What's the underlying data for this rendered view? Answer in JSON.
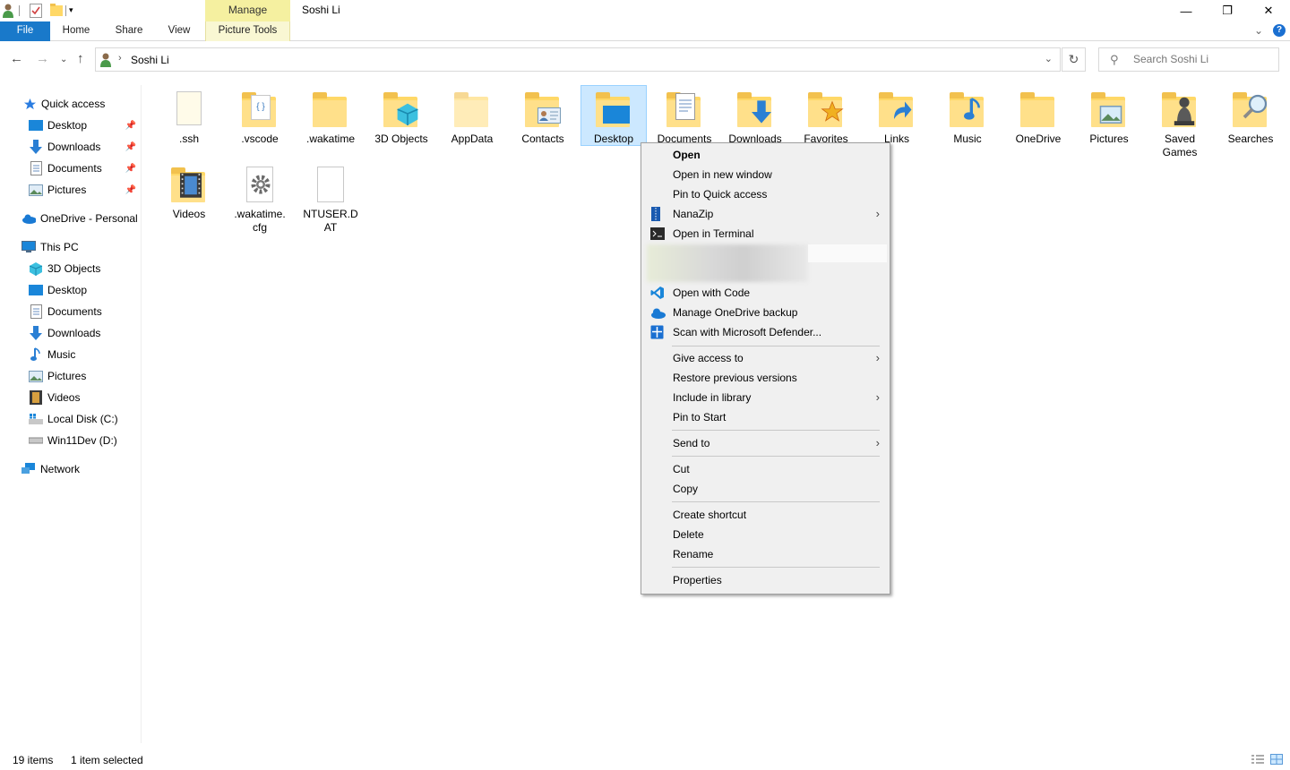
{
  "titlebar": {
    "context_tab": "Manage",
    "title": "Soshi Li",
    "minimize": "—",
    "restore": "❐",
    "close": "✕"
  },
  "ribbon": {
    "tabs": [
      "File",
      "Home",
      "Share",
      "View",
      "Picture Tools"
    ],
    "expand": "⌄",
    "help": "?"
  },
  "address": {
    "path": "Soshi Li",
    "separator": "›",
    "dropdown": "⌄",
    "refresh": "↻"
  },
  "search": {
    "placeholder": "Search Soshi Li"
  },
  "nav": {
    "quick_access": "Quick access",
    "quick_items": [
      "Desktop",
      "Downloads",
      "Documents",
      "Pictures"
    ],
    "onedrive": "OneDrive - Personal",
    "this_pc": "This PC",
    "pc_items": [
      "3D Objects",
      "Desktop",
      "Documents",
      "Downloads",
      "Music",
      "Pictures",
      "Videos",
      "Local Disk (C:)",
      "Win11Dev (D:)"
    ],
    "network": "Network"
  },
  "items": [
    {
      "label": ".ssh",
      "type": "folder"
    },
    {
      "label": ".vscode",
      "type": "folder"
    },
    {
      "label": ".wakatime",
      "type": "folder"
    },
    {
      "label": "3D Objects",
      "type": "folder"
    },
    {
      "label": "AppData",
      "type": "folder"
    },
    {
      "label": "Contacts",
      "type": "folder"
    },
    {
      "label": "Desktop",
      "type": "folder",
      "selected": true
    },
    {
      "label": "Documents",
      "type": "folder"
    },
    {
      "label": "Downloads",
      "type": "folder"
    },
    {
      "label": "Favorites",
      "type": "folder"
    },
    {
      "label": "Links",
      "type": "folder"
    },
    {
      "label": "Music",
      "type": "folder"
    },
    {
      "label": "OneDrive",
      "type": "folder"
    },
    {
      "label": "Pictures",
      "type": "folder"
    },
    {
      "label": "Saved Games",
      "type": "folder"
    },
    {
      "label": "Searches",
      "type": "folder"
    },
    {
      "label": "Videos",
      "type": "folder"
    },
    {
      "label": ".wakatime.cfg",
      "type": "file"
    },
    {
      "label": "NTUSER.DAT",
      "type": "file"
    }
  ],
  "context_menu": {
    "items": [
      "Open",
      "Open in new window",
      "Pin to Quick access",
      "NanaZip",
      "Open in Terminal",
      "Open with Code",
      "Manage OneDrive backup",
      "Scan with Microsoft Defender...",
      "Give access to",
      "Restore previous versions",
      "Include in library",
      "Pin to Start",
      "Send to",
      "Cut",
      "Copy",
      "Create shortcut",
      "Delete",
      "Rename",
      "Properties"
    ],
    "submenu_arrow": "›"
  },
  "status": {
    "count": "19 items",
    "selection": "1 item selected"
  },
  "colors": {
    "accent": "#1979ca",
    "selection": "#cce8ff",
    "manage_tab": "#f5f0a0",
    "folder": "#ffd867"
  }
}
